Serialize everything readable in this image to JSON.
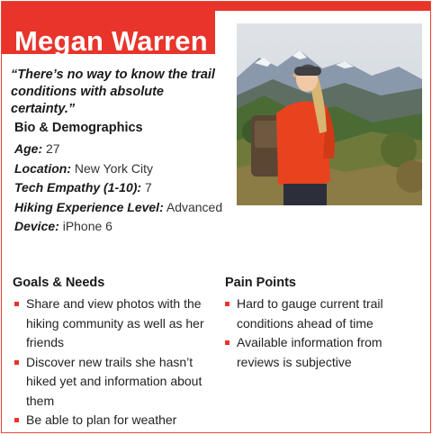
{
  "persona": {
    "name": "Megan Warren",
    "quote": "“There’s no way to know the trail conditions with absolute certainty.”",
    "bio_title": "Bio & Demographics",
    "bio": [
      {
        "key": "Age:",
        "value": " 27"
      },
      {
        "key": "Location:",
        "value": " New York City"
      },
      {
        "key": "Tech Empathy (1-10):",
        "value": " 7"
      },
      {
        "key": "Hiking Experience Level:",
        "value": " Advanced"
      },
      {
        "key": "Device:",
        "value": " iPhone 6"
      }
    ],
    "goals_title": "Goals & Needs",
    "goals": [
      "Share and view photos with the hiking community as well as her friends",
      "Discover new trails she hasn’t hiked yet and information about them",
      "Be able to plan for weather conditions"
    ],
    "pain_title": "Pain Points",
    "pains": [
      "Hard to gauge current trail conditions ahead of time",
      "Available information from reviews is subjective"
    ]
  },
  "colors": {
    "accent": "#e8342a"
  }
}
